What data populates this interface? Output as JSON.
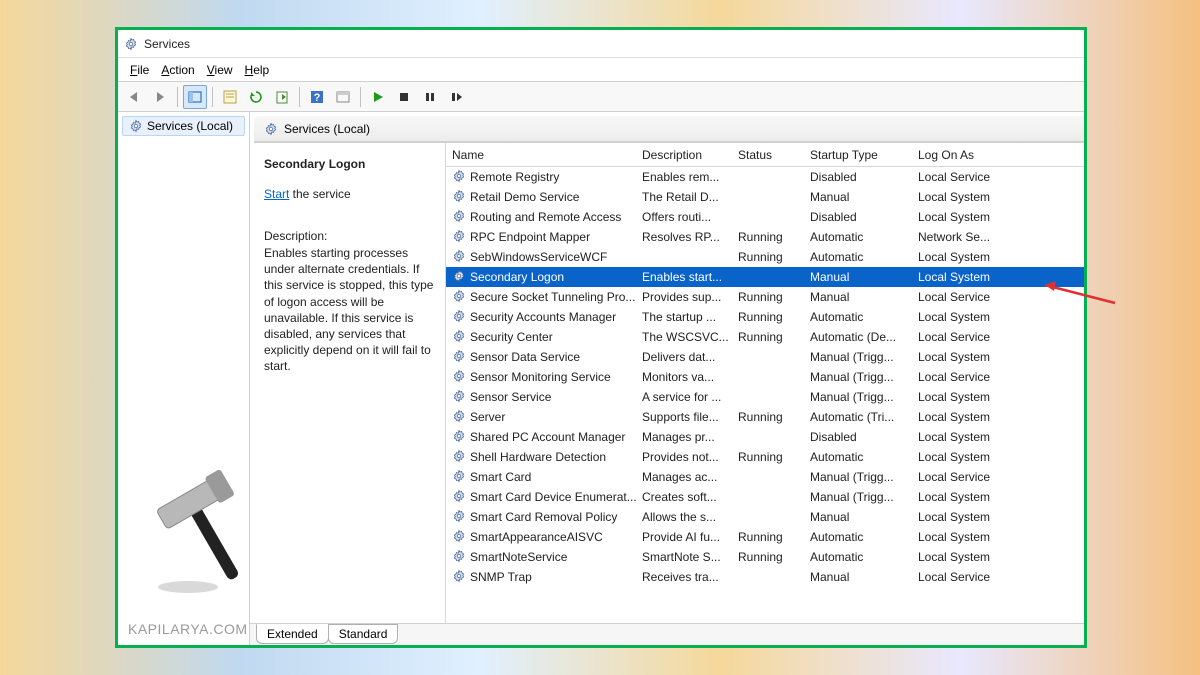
{
  "window": {
    "title": "Services"
  },
  "menu": {
    "file": "File",
    "action": "Action",
    "view": "View",
    "help": "Help"
  },
  "nav": {
    "item0": "Services (Local)"
  },
  "pane": {
    "header": "Services (Local)"
  },
  "detail": {
    "title": "Secondary Logon",
    "action_link": "Start",
    "action_suffix": " the service",
    "desc_label": "Description:",
    "desc_text": "Enables starting processes under alternate credentials. If this service is stopped, this type of logon access will be unavailable. If this service is disabled, any services that explicitly depend on it will fail to start."
  },
  "columns": {
    "name": "Name",
    "description": "Description",
    "status": "Status",
    "startup": "Startup Type",
    "logon": "Log On As"
  },
  "rows": [
    {
      "name": "Remote Registry",
      "description": "Enables rem...",
      "status": "",
      "startup": "Disabled",
      "logon": "Local Service"
    },
    {
      "name": "Retail Demo Service",
      "description": "The Retail D...",
      "status": "",
      "startup": "Manual",
      "logon": "Local System"
    },
    {
      "name": "Routing and Remote Access",
      "description": "Offers routi...",
      "status": "",
      "startup": "Disabled",
      "logon": "Local System"
    },
    {
      "name": "RPC Endpoint Mapper",
      "description": "Resolves RP...",
      "status": "Running",
      "startup": "Automatic",
      "logon": "Network Se..."
    },
    {
      "name": "SebWindowsServiceWCF",
      "description": "",
      "status": "Running",
      "startup": "Automatic",
      "logon": "Local System"
    },
    {
      "name": "Secondary Logon",
      "description": "Enables start...",
      "status": "",
      "startup": "Manual",
      "logon": "Local System",
      "selected": true
    },
    {
      "name": "Secure Socket Tunneling Pro...",
      "description": "Provides sup...",
      "status": "Running",
      "startup": "Manual",
      "logon": "Local Service"
    },
    {
      "name": "Security Accounts Manager",
      "description": "The startup ...",
      "status": "Running",
      "startup": "Automatic",
      "logon": "Local System"
    },
    {
      "name": "Security Center",
      "description": "The WSCSVC...",
      "status": "Running",
      "startup": "Automatic (De...",
      "logon": "Local Service"
    },
    {
      "name": "Sensor Data Service",
      "description": "Delivers dat...",
      "status": "",
      "startup": "Manual (Trigg...",
      "logon": "Local System"
    },
    {
      "name": "Sensor Monitoring Service",
      "description": "Monitors va...",
      "status": "",
      "startup": "Manual (Trigg...",
      "logon": "Local Service"
    },
    {
      "name": "Sensor Service",
      "description": "A service for ...",
      "status": "",
      "startup": "Manual (Trigg...",
      "logon": "Local System"
    },
    {
      "name": "Server",
      "description": "Supports file...",
      "status": "Running",
      "startup": "Automatic (Tri...",
      "logon": "Local System"
    },
    {
      "name": "Shared PC Account Manager",
      "description": "Manages pr...",
      "status": "",
      "startup": "Disabled",
      "logon": "Local System"
    },
    {
      "name": "Shell Hardware Detection",
      "description": "Provides not...",
      "status": "Running",
      "startup": "Automatic",
      "logon": "Local System"
    },
    {
      "name": "Smart Card",
      "description": "Manages ac...",
      "status": "",
      "startup": "Manual (Trigg...",
      "logon": "Local Service"
    },
    {
      "name": "Smart Card Device Enumerat...",
      "description": "Creates soft...",
      "status": "",
      "startup": "Manual (Trigg...",
      "logon": "Local System"
    },
    {
      "name": "Smart Card Removal Policy",
      "description": "Allows the s...",
      "status": "",
      "startup": "Manual",
      "logon": "Local System"
    },
    {
      "name": "SmartAppearanceAISVC",
      "description": "Provide AI fu...",
      "status": "Running",
      "startup": "Automatic",
      "logon": "Local System"
    },
    {
      "name": "SmartNoteService",
      "description": "SmartNote S...",
      "status": "Running",
      "startup": "Automatic",
      "logon": "Local System"
    },
    {
      "name": "SNMP Trap",
      "description": "Receives tra...",
      "status": "",
      "startup": "Manual",
      "logon": "Local Service"
    }
  ],
  "tabs": {
    "extended": "Extended",
    "standard": "Standard"
  },
  "watermark": "KAPILARYA.COM"
}
